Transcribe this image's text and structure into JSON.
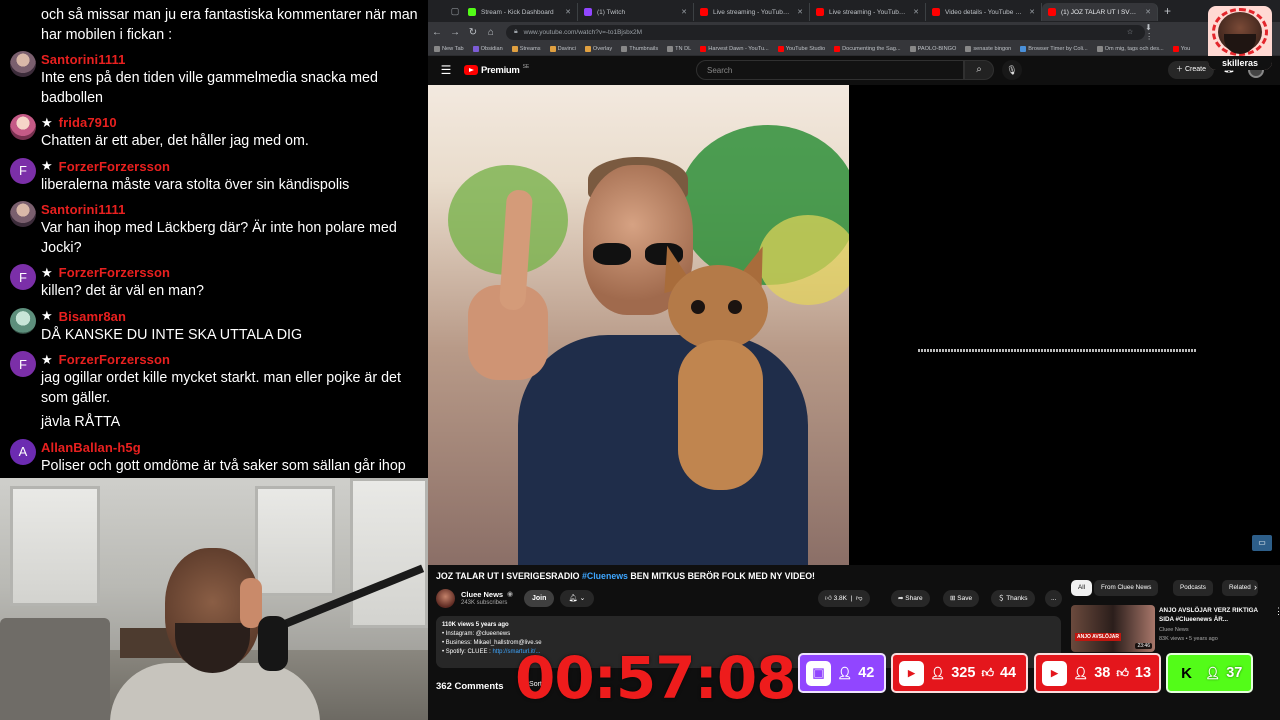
{
  "chat": {
    "messages": [
      {
        "user": "",
        "text": "och så missar man ju era fantastiska kommentarer när man har mobilen i fickan :",
        "star": false,
        "avatar": ""
      },
      {
        "user": "Santorini1111",
        "text": "Inte ens på den tiden ville gammelmedia snacka med badbollen",
        "star": false,
        "avatar": "S"
      },
      {
        "user": "frida7910",
        "text": "Chatten är ett aber, det håller jag med om.",
        "star": true,
        "avatar": "F7"
      },
      {
        "user": "ForzerForzersson",
        "text": "liberalerna måste vara stolta över sin kändispolis",
        "star": true,
        "avatar": "F"
      },
      {
        "user": "Santorini1111",
        "text": "Var han ihop med Läckberg där? Är inte hon polare med Jocki?",
        "star": false,
        "avatar": "S"
      },
      {
        "user": "ForzerForzersson",
        "text": "killen? det är väl en man?",
        "star": true,
        "avatar": "F"
      },
      {
        "user": "Bisamr8an",
        "text": "DÅ KANSKE DU INTE SKA UTTALA DIG",
        "star": true,
        "avatar": "B"
      },
      {
        "user": "ForzerForzersson",
        "text": "jag ogillar ordet kille mycket starkt. man eller pojke är det som gäller.",
        "star": true,
        "avatar": "F"
      },
      {
        "user": "",
        "text": "jävla RÅTTA",
        "star": false,
        "avatar": ""
      },
      {
        "user": "AllanBallan-h5g",
        "text": "Poliser och gott omdöme är två saker som sällan går ihop",
        "star": false,
        "avatar": "A"
      }
    ]
  },
  "browser": {
    "tabs": [
      {
        "title": "Stream - Kick Dashboard",
        "color": "#53fc18"
      },
      {
        "title": "(1) Twitch",
        "color": "#9146ff"
      },
      {
        "title": "Live streaming - YouTube Studio",
        "color": "#ff0000"
      },
      {
        "title": "Live streaming - YouTube Studio",
        "color": "#ff0000"
      },
      {
        "title": "Video details - YouTube Studio",
        "color": "#ff0000"
      },
      {
        "title": "(1) JOZ TALAR UT I SVERIGES",
        "color": "#ff0000"
      }
    ],
    "url": "www.youtube.com/watch?v=-to1Bjsbx2M",
    "bookmarks": [
      {
        "label": "New Tab",
        "color": "#888"
      },
      {
        "label": "Obsidian",
        "color": "#7c5cd6"
      },
      {
        "label": "Streams",
        "color": "#e0a040"
      },
      {
        "label": "Davinci",
        "color": "#e0a040"
      },
      {
        "label": "Overlay",
        "color": "#e0a040"
      },
      {
        "label": "Thumbnails",
        "color": "#888"
      },
      {
        "label": "TN DL",
        "color": "#888"
      },
      {
        "label": "Harvest Dawn - YouTu...",
        "color": "#ff0000"
      },
      {
        "label": "YouTube Studio",
        "color": "#ff0000"
      },
      {
        "label": "Documenting the Sag...",
        "color": "#ff0000"
      },
      {
        "label": "PAOLO-BINGO",
        "color": "#888"
      },
      {
        "label": "senaste bingon",
        "color": "#888"
      },
      {
        "label": "Browser Timer by Coli...",
        "color": "#4a90d9"
      },
      {
        "label": "Om mig, tags och des...",
        "color": "#888"
      },
      {
        "label": "You",
        "color": "#ff0000"
      }
    ]
  },
  "youtube": {
    "logo": "Premium",
    "logo_sup": "SE",
    "search_placeholder": "Search",
    "create_label": "Create",
    "title_prefix": "JOZ TALAR UT I SVERIGESRADIO ",
    "title_hashtag": "#Cluenews",
    "title_suffix": " BEN MITKUS BERÖR FOLK MED NY VIDEO!",
    "channel": {
      "name": "Cluee News",
      "subs": "243K subscribers",
      "join": "Join"
    },
    "actions": {
      "likes": "3.8K",
      "share": "Share",
      "save": "Save",
      "thanks": "Thanks",
      "more": "..."
    },
    "description": {
      "meta": "110K views  5 years ago",
      "lines": [
        "• Instagram: @clueenews",
        "• Business: Mikael_hallstrom@live.se",
        "• Spotify: CLUEE : "
      ],
      "link": "http://smarturl.it/..."
    },
    "comments_count": "362 Comments",
    "sort_by": "Sort by",
    "chips": [
      "All",
      "From Cluee News",
      "Podcasts",
      "Related"
    ],
    "recommendation": {
      "title": "ANJO AVSLÖJAR VERZ RIKTIGA SIDA #Clueenews ÄR...",
      "channel": "Cluee News",
      "meta": "83K views • 5 years ago",
      "duration": "23:46",
      "thumb_text": "ANJO AVSLÖJAR"
    }
  },
  "overlay": {
    "streamer_name": "skilleras",
    "timer": "00:57:08",
    "badges": {
      "twitch_viewers": "42",
      "yt1_viewers": "325",
      "yt1_likes": "44",
      "yt2_viewers": "38",
      "yt2_likes": "13",
      "kick_viewers": "37"
    }
  }
}
